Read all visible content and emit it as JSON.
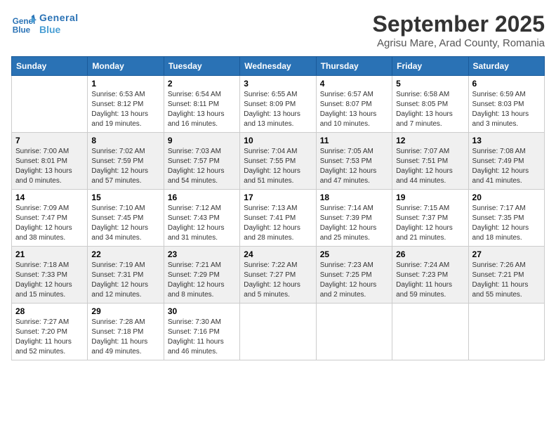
{
  "header": {
    "logo_line1": "General",
    "logo_line2": "Blue",
    "month": "September 2025",
    "location": "Agrisu Mare, Arad County, Romania"
  },
  "days_of_week": [
    "Sunday",
    "Monday",
    "Tuesday",
    "Wednesday",
    "Thursday",
    "Friday",
    "Saturday"
  ],
  "weeks": [
    [
      {
        "day": "",
        "info": ""
      },
      {
        "day": "1",
        "info": "Sunrise: 6:53 AM\nSunset: 8:12 PM\nDaylight: 13 hours\nand 19 minutes."
      },
      {
        "day": "2",
        "info": "Sunrise: 6:54 AM\nSunset: 8:11 PM\nDaylight: 13 hours\nand 16 minutes."
      },
      {
        "day": "3",
        "info": "Sunrise: 6:55 AM\nSunset: 8:09 PM\nDaylight: 13 hours\nand 13 minutes."
      },
      {
        "day": "4",
        "info": "Sunrise: 6:57 AM\nSunset: 8:07 PM\nDaylight: 13 hours\nand 10 minutes."
      },
      {
        "day": "5",
        "info": "Sunrise: 6:58 AM\nSunset: 8:05 PM\nDaylight: 13 hours\nand 7 minutes."
      },
      {
        "day": "6",
        "info": "Sunrise: 6:59 AM\nSunset: 8:03 PM\nDaylight: 13 hours\nand 3 minutes."
      }
    ],
    [
      {
        "day": "7",
        "info": "Sunrise: 7:00 AM\nSunset: 8:01 PM\nDaylight: 13 hours\nand 0 minutes."
      },
      {
        "day": "8",
        "info": "Sunrise: 7:02 AM\nSunset: 7:59 PM\nDaylight: 12 hours\nand 57 minutes."
      },
      {
        "day": "9",
        "info": "Sunrise: 7:03 AM\nSunset: 7:57 PM\nDaylight: 12 hours\nand 54 minutes."
      },
      {
        "day": "10",
        "info": "Sunrise: 7:04 AM\nSunset: 7:55 PM\nDaylight: 12 hours\nand 51 minutes."
      },
      {
        "day": "11",
        "info": "Sunrise: 7:05 AM\nSunset: 7:53 PM\nDaylight: 12 hours\nand 47 minutes."
      },
      {
        "day": "12",
        "info": "Sunrise: 7:07 AM\nSunset: 7:51 PM\nDaylight: 12 hours\nand 44 minutes."
      },
      {
        "day": "13",
        "info": "Sunrise: 7:08 AM\nSunset: 7:49 PM\nDaylight: 12 hours\nand 41 minutes."
      }
    ],
    [
      {
        "day": "14",
        "info": "Sunrise: 7:09 AM\nSunset: 7:47 PM\nDaylight: 12 hours\nand 38 minutes."
      },
      {
        "day": "15",
        "info": "Sunrise: 7:10 AM\nSunset: 7:45 PM\nDaylight: 12 hours\nand 34 minutes."
      },
      {
        "day": "16",
        "info": "Sunrise: 7:12 AM\nSunset: 7:43 PM\nDaylight: 12 hours\nand 31 minutes."
      },
      {
        "day": "17",
        "info": "Sunrise: 7:13 AM\nSunset: 7:41 PM\nDaylight: 12 hours\nand 28 minutes."
      },
      {
        "day": "18",
        "info": "Sunrise: 7:14 AM\nSunset: 7:39 PM\nDaylight: 12 hours\nand 25 minutes."
      },
      {
        "day": "19",
        "info": "Sunrise: 7:15 AM\nSunset: 7:37 PM\nDaylight: 12 hours\nand 21 minutes."
      },
      {
        "day": "20",
        "info": "Sunrise: 7:17 AM\nSunset: 7:35 PM\nDaylight: 12 hours\nand 18 minutes."
      }
    ],
    [
      {
        "day": "21",
        "info": "Sunrise: 7:18 AM\nSunset: 7:33 PM\nDaylight: 12 hours\nand 15 minutes."
      },
      {
        "day": "22",
        "info": "Sunrise: 7:19 AM\nSunset: 7:31 PM\nDaylight: 12 hours\nand 12 minutes."
      },
      {
        "day": "23",
        "info": "Sunrise: 7:21 AM\nSunset: 7:29 PM\nDaylight: 12 hours\nand 8 minutes."
      },
      {
        "day": "24",
        "info": "Sunrise: 7:22 AM\nSunset: 7:27 PM\nDaylight: 12 hours\nand 5 minutes."
      },
      {
        "day": "25",
        "info": "Sunrise: 7:23 AM\nSunset: 7:25 PM\nDaylight: 12 hours\nand 2 minutes."
      },
      {
        "day": "26",
        "info": "Sunrise: 7:24 AM\nSunset: 7:23 PM\nDaylight: 11 hours\nand 59 minutes."
      },
      {
        "day": "27",
        "info": "Sunrise: 7:26 AM\nSunset: 7:21 PM\nDaylight: 11 hours\nand 55 minutes."
      }
    ],
    [
      {
        "day": "28",
        "info": "Sunrise: 7:27 AM\nSunset: 7:20 PM\nDaylight: 11 hours\nand 52 minutes."
      },
      {
        "day": "29",
        "info": "Sunrise: 7:28 AM\nSunset: 7:18 PM\nDaylight: 11 hours\nand 49 minutes."
      },
      {
        "day": "30",
        "info": "Sunrise: 7:30 AM\nSunset: 7:16 PM\nDaylight: 11 hours\nand 46 minutes."
      },
      {
        "day": "",
        "info": ""
      },
      {
        "day": "",
        "info": ""
      },
      {
        "day": "",
        "info": ""
      },
      {
        "day": "",
        "info": ""
      }
    ]
  ]
}
